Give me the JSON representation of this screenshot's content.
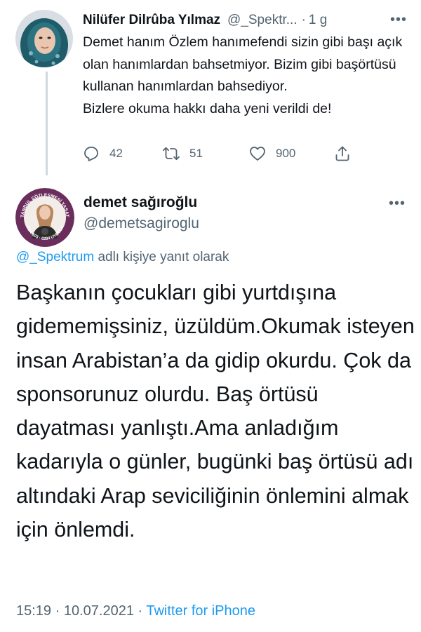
{
  "parent_tweet": {
    "display_name": "Nilüfer Dilrûba Yılmaz",
    "handle": "@_Spektr...",
    "separator": "·",
    "time": "1 g",
    "more": "•••",
    "text": "Demet hanım Özlem hanımefendi sizin gibi başı açık olan hanımlardan bahsetmiyor. Bizim gibi başörtüsü kullanan hanımlardan bahsediyor.\nBizlere okuma hakkı daha yeni verildi de!",
    "actions": {
      "reply": {
        "icon": "reply-icon",
        "count": "42"
      },
      "retweet": {
        "icon": "retweet-icon",
        "count": "51"
      },
      "like": {
        "icon": "heart-icon",
        "count": "900"
      },
      "share": {
        "icon": "share-icon"
      }
    }
  },
  "main_tweet": {
    "display_name": "demet sağıroğlu",
    "handle": "@demetsagiroglu",
    "more": "•••",
    "avatar_badge_text": [
      "İSTANBUL SÖZLEŞMESİ YAŞATIR",
      "TCK-103",
      "6284 UYGULA"
    ],
    "reply_to_handle": "@_Spektrum",
    "reply_to_suffix": " adlı kişiye yanıt olarak",
    "text": "Başkanın çocukları gibi yurtdışına gidememişsiniz, üzüldüm.Okumak isteyen insan Arabistan’a da gidip okurdu. Çok da sponsorunuz olurdu. Baş örtüsü dayatması yanlıştı.Ama anladığım kadarıyla o günler, bugünki baş örtüsü adı altındaki Arap seviciliğinin önlemini almak için önlemdi.",
    "time": "15:19",
    "separator": " · ",
    "date": "10.07.2021",
    "source": "Twitter for iPhone"
  },
  "colors": {
    "text": "#0f1419",
    "muted": "#536471",
    "link": "#1d9bf0",
    "divider": "#cfd9de",
    "avatar_ring": "#6b2d5c"
  }
}
